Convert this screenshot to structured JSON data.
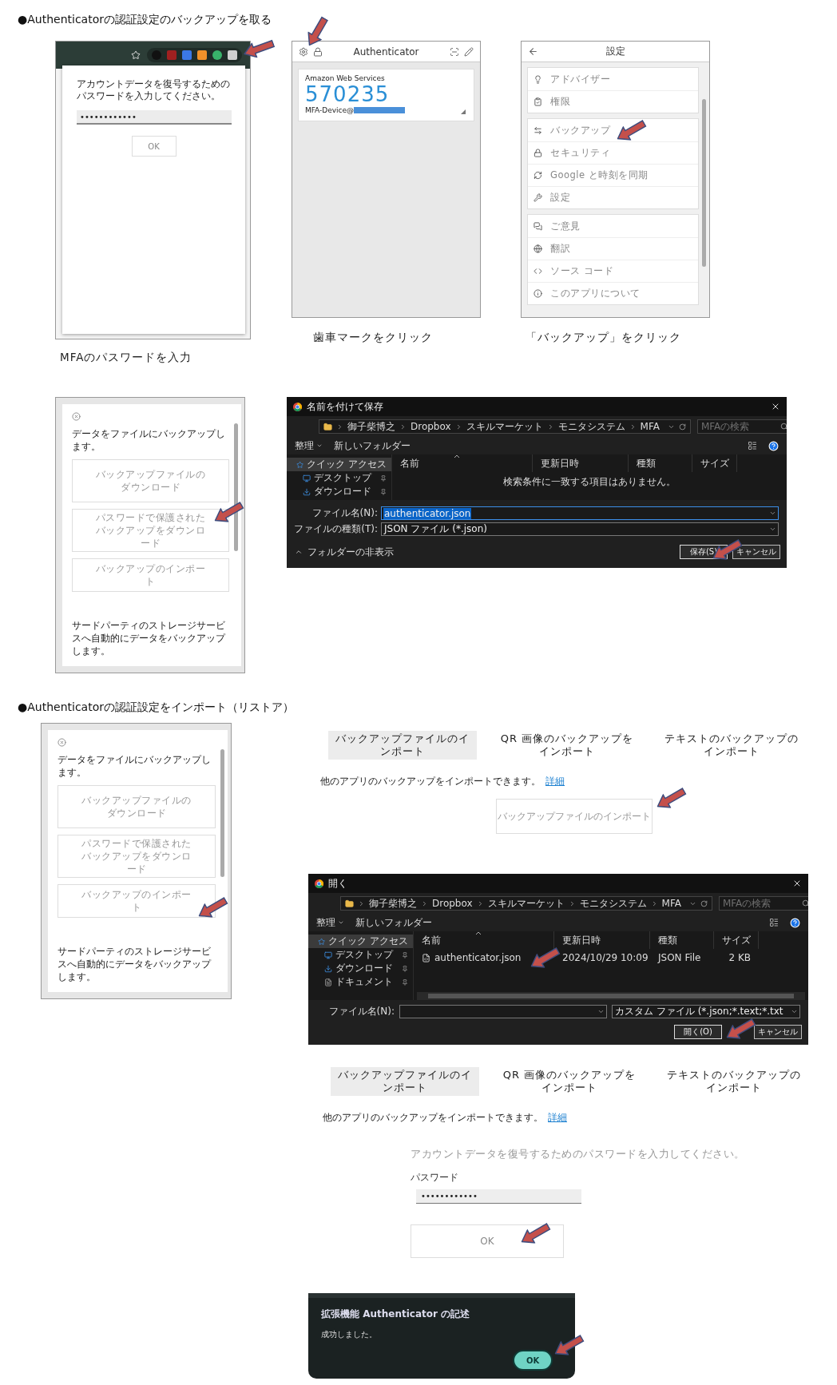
{
  "backup": {
    "heading": "●Authenticatorの認証設定のバックアップを取る",
    "password_step": {
      "prompt": "アカウントデータを復号するためのパスワードを入力してください。",
      "password": "••••••••••••",
      "button": "OK",
      "caption": "MFAのパスワードを入力"
    },
    "gear_step": {
      "title": "Authenticator",
      "issuer": "Amazon Web Services",
      "code": "570235",
      "account": "MFA-Device@",
      "caption": "歯車マークをクリック"
    },
    "settings_step": {
      "title": "設定",
      "groups": [
        {
          "items": [
            {
              "label": "アドバイザー"
            },
            {
              "label": "権限"
            }
          ]
        },
        {
          "items": [
            {
              "label": "バックアップ"
            },
            {
              "label": "セキュリティ"
            },
            {
              "label": "Google と時刻を同期"
            },
            {
              "label": "設定"
            }
          ]
        },
        {
          "items": [
            {
              "label": "ご意見"
            },
            {
              "label": "翻訳"
            },
            {
              "label": "ソース コード"
            },
            {
              "label": "このアプリについて"
            }
          ]
        }
      ],
      "caption": "「バックアップ」をクリック"
    },
    "backup_menu": {
      "intro": "データをファイルにバックアップします。",
      "buttons": [
        "バックアップファイルのダウンロード",
        "パスワードで保護されたバックアップをダウンロード",
        "バックアップのインポート"
      ],
      "footer": "サードパーティのストレージサービスへ自動的にデータをバックアップします。"
    },
    "save_dialog": {
      "title": "名前を付けて保存",
      "path": [
        "御子柴博之",
        "Dropbox",
        "スキルマーケット",
        "モニタシステム",
        "MFA"
      ],
      "search_placeholder": "MFAの検索",
      "organize": "整理",
      "new_folder": "新しいフォルダー",
      "nav": [
        {
          "label": "クイック アクセス",
          "selected": true
        },
        {
          "label": "デスクトップ",
          "selected": false
        },
        {
          "label": "ダウンロード",
          "selected": false
        }
      ],
      "columns": [
        "名前",
        "更新日時",
        "種類",
        "サイズ"
      ],
      "empty_message": "検索条件に一致する項目はありません。",
      "fields": [
        {
          "label": "ファイル名(N):",
          "value": "authenticator.json",
          "selected": true
        },
        {
          "label": "ファイルの種類(T):",
          "value": "JSON ファイル (*.json)",
          "selected": false
        }
      ],
      "hide_folders": "フォルダーの非表示",
      "buttons": [
        "保存(S)",
        "キャンセル"
      ]
    }
  },
  "restore": {
    "heading": "●Authenticatorの認証設定をインポート（リストア）",
    "backup_menu": {
      "intro": "データをファイルにバックアップします。",
      "buttons": [
        "バックアップファイルのダウンロード",
        "パスワードで保護されたバックアップをダウンロード",
        "バックアップのインポート"
      ],
      "footer": "サードパーティのストレージサービスへ自動的にデータをバックアップします。"
    },
    "import_tabs": {
      "tabs": [
        {
          "label": "バックアップファイルのインポート",
          "selected": true
        },
        {
          "label": "QR 画像のバックアップをインポート",
          "selected": false
        },
        {
          "label": "テキストのバックアップのインポート",
          "selected": false
        }
      ],
      "description": "他のアプリのバックアップをインポートできます。",
      "link": "詳細",
      "import_button": "バックアップファイルのインポート"
    },
    "open_dialog": {
      "title": "開く",
      "path": [
        "御子柴博之",
        "Dropbox",
        "スキルマーケット",
        "モニタシステム",
        "MFA"
      ],
      "search_placeholder": "MFAの検索",
      "organize": "整理",
      "new_folder": "新しいフォルダー",
      "nav": [
        {
          "label": "クイック アクセス",
          "selected": true
        },
        {
          "label": "デスクトップ",
          "selected": false
        },
        {
          "label": "ダウンロード",
          "selected": false
        },
        {
          "label": "ドキュメント",
          "selected": false
        }
      ],
      "columns": [
        "名前",
        "更新日時",
        "種類",
        "サイズ"
      ],
      "files": [
        {
          "name": "authenticator.json",
          "modified": "2024/10/29 10:09",
          "type": "JSON File",
          "size": "2 KB"
        }
      ],
      "filename_label": "ファイル名(N):",
      "filter": "カスタム ファイル (*.json;*.text;*.txt",
      "buttons": [
        "開く(O)",
        "キャンセル"
      ]
    },
    "password_tabs": {
      "tabs": [
        {
          "label": "バックアップファイルのインポート",
          "selected": true
        },
        {
          "label": "QR 画像のバックアップをインポート",
          "selected": false
        },
        {
          "label": "テキストのバックアップのインポート",
          "selected": false
        }
      ],
      "description": "他のアプリのバックアップをインポートできます。",
      "link": "詳細"
    },
    "password_form": {
      "prompt": "アカウントデータを復号するためのパスワードを入力してください。",
      "label": "パスワード",
      "password": "••••••••••••",
      "button": "OK"
    },
    "success_dialog": {
      "title": "拡張機能 Authenticator の記述",
      "message": "成功しました。",
      "button": "OK"
    }
  }
}
